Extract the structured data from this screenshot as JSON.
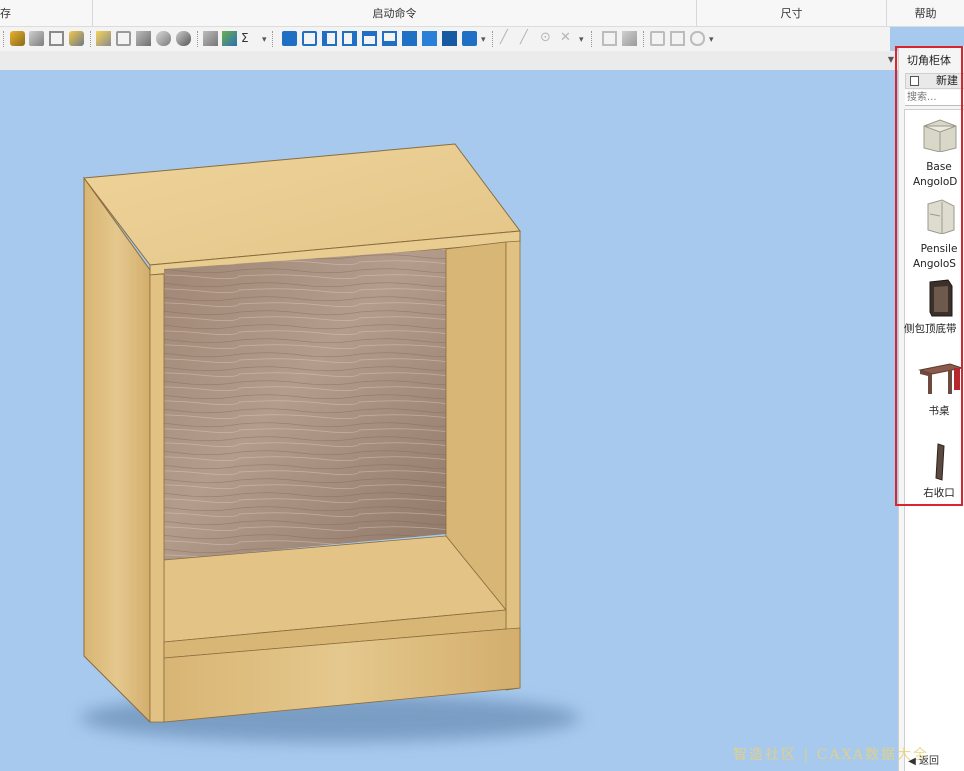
{
  "ribbon": {
    "groups": [
      {
        "label": "存"
      },
      {
        "label": "启动命令"
      },
      {
        "label": "尺寸"
      },
      {
        "label": "帮助"
      }
    ]
  },
  "panel": {
    "title": "切角柜体",
    "new_label": "新建",
    "search_placeholder": "搜索...",
    "items": [
      {
        "line1": "Base",
        "line2": "AngoloD",
        "icon": "corner-base-cabinet-icon"
      },
      {
        "line1": "Pensile",
        "line2": "AngoloS",
        "icon": "corner-wall-cabinet-icon"
      },
      {
        "line1": "侧包顶底带",
        "line2": "",
        "icon": "side-wrap-cabinet-icon"
      },
      {
        "line1": "书桌",
        "line2": "",
        "icon": "desk-icon"
      },
      {
        "line1": "右收口",
        "line2": "",
        "icon": "right-closing-panel-icon"
      }
    ],
    "back_label": "返回"
  },
  "watermark": "智造社区 | CAXA数据大全",
  "colors": {
    "viewport_bg": "#a7c9ee",
    "highlight": "#d9252e",
    "wood_light": "#e2c283",
    "wood_back": "#a0897a"
  }
}
